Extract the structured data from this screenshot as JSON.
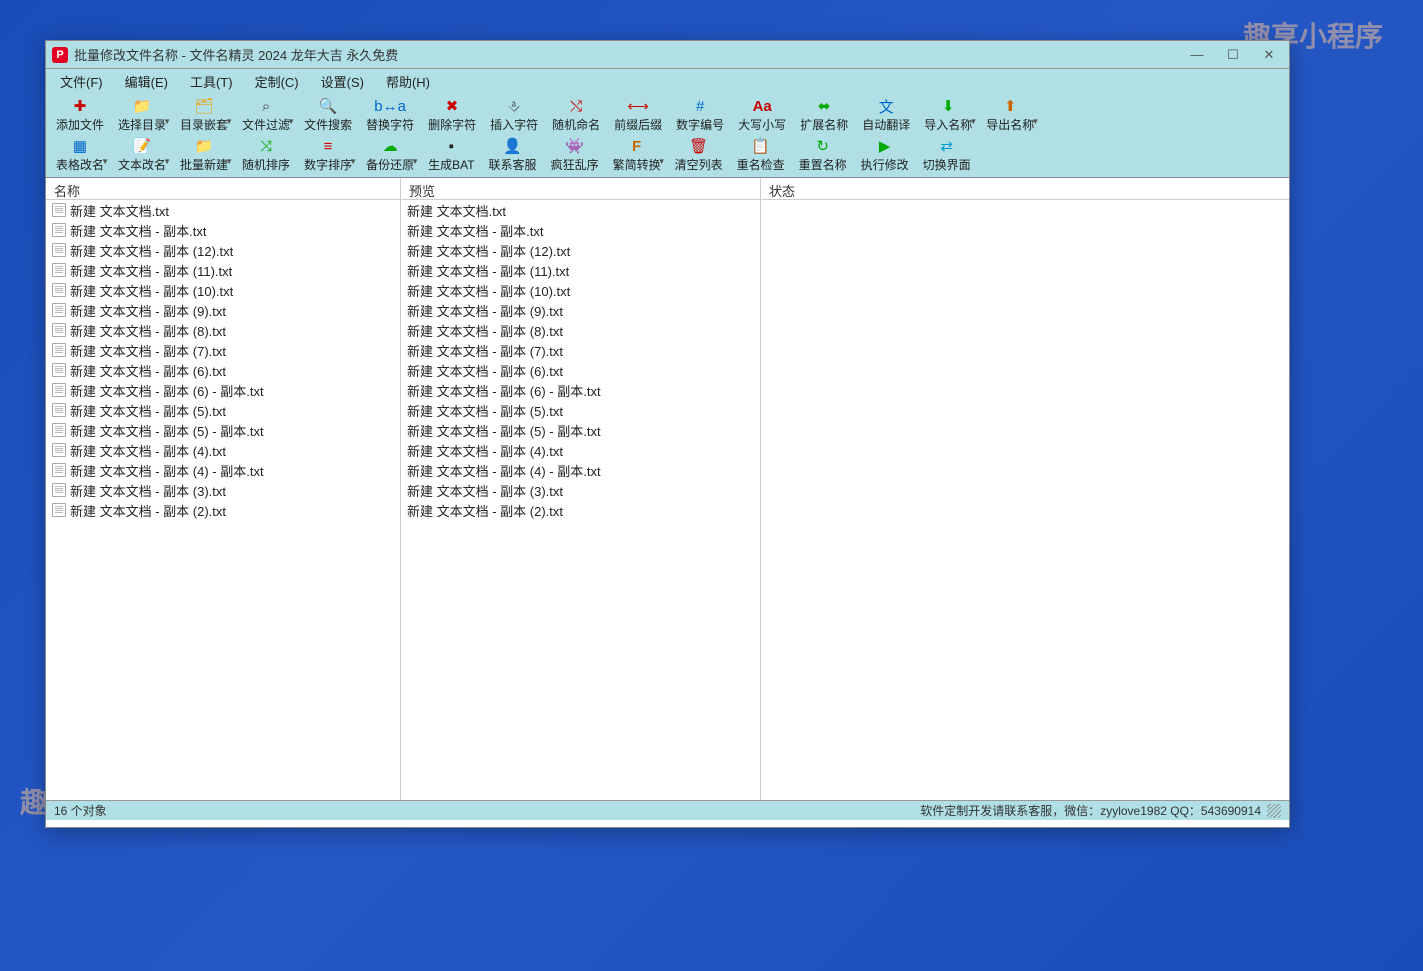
{
  "window": {
    "title": "批量修改文件名称 -  文件名精灵 2024 龙年大吉 永久免费"
  },
  "menu": {
    "file": "文件(F)",
    "edit": "编辑(E)",
    "tool": "工具(T)",
    "custom": "定制(C)",
    "settings": "设置(S)",
    "help": "帮助(H)"
  },
  "toolbar1": {
    "add_file": "添加文件",
    "select_dir": "选择目录",
    "dir_nest": "目录嵌套",
    "file_filter": "文件过滤",
    "file_search": "文件搜索",
    "replace_char": "替换字符",
    "delete_char": "删除字符",
    "insert_char": "插入字符",
    "random_name": "随机命名",
    "prefix_suffix": "前缀后缀",
    "number_seq": "数字编号",
    "case": "大写小写",
    "ext_name": "扩展名称",
    "auto_translate": "自动翻译",
    "import_name": "导入名称",
    "export_name": "导出名称"
  },
  "toolbar2": {
    "table_rename": "表格改名",
    "text_rename": "文本改名",
    "batch_new": "批量新建",
    "random_sort": "随机排序",
    "number_sort": "数字排序",
    "backup_restore": "备份还原",
    "gen_bat": "生成BAT",
    "contact": "联系客服",
    "crazy_shuffle": "疯狂乱序",
    "trad_simp": "繁简转换",
    "clear_list": "清空列表",
    "dup_check": "重名检查",
    "reset_name": "重置名称",
    "execute": "执行修改",
    "switch_ui": "切换界面"
  },
  "columns": {
    "name": "名称",
    "preview": "预览",
    "status": "状态"
  },
  "files": [
    {
      "name": "新建 文本文档.txt",
      "preview": "新建 文本文档.txt"
    },
    {
      "name": "新建 文本文档 - 副本.txt",
      "preview": "新建 文本文档 - 副本.txt"
    },
    {
      "name": "新建 文本文档 - 副本 (12).txt",
      "preview": "新建 文本文档 - 副本 (12).txt"
    },
    {
      "name": "新建 文本文档 - 副本 (11).txt",
      "preview": "新建 文本文档 - 副本 (11).txt"
    },
    {
      "name": "新建 文本文档 - 副本 (10).txt",
      "preview": "新建 文本文档 - 副本 (10).txt"
    },
    {
      "name": "新建 文本文档 - 副本 (9).txt",
      "preview": "新建 文本文档 - 副本 (9).txt"
    },
    {
      "name": "新建 文本文档 - 副本 (8).txt",
      "preview": "新建 文本文档 - 副本 (8).txt"
    },
    {
      "name": "新建 文本文档 - 副本 (7).txt",
      "preview": "新建 文本文档 - 副本 (7).txt"
    },
    {
      "name": "新建 文本文档 - 副本 (6).txt",
      "preview": "新建 文本文档 - 副本 (6).txt"
    },
    {
      "name": "新建 文本文档 - 副本 (6) - 副本.txt",
      "preview": "新建 文本文档 - 副本 (6) - 副本.txt"
    },
    {
      "name": "新建 文本文档 - 副本 (5).txt",
      "preview": "新建 文本文档 - 副本 (5).txt"
    },
    {
      "name": "新建 文本文档 - 副本 (5) - 副本.txt",
      "preview": "新建 文本文档 - 副本 (5) - 副本.txt"
    },
    {
      "name": "新建 文本文档 - 副本 (4).txt",
      "preview": "新建 文本文档 - 副本 (4).txt"
    },
    {
      "name": "新建 文本文档 - 副本 (4) - 副本.txt",
      "preview": "新建 文本文档 - 副本 (4) - 副本.txt"
    },
    {
      "name": "新建 文本文档 - 副本 (3).txt",
      "preview": "新建 文本文档 - 副本 (3).txt"
    },
    {
      "name": "新建 文本文档 - 副本 (2).txt",
      "preview": "新建 文本文档 - 副本 (2).txt"
    }
  ],
  "status": {
    "count": "16 个对象",
    "footer": "软件定制开发请联系客服，微信：zyylove1982  QQ：543690914"
  },
  "watermark": "趣享小程序"
}
